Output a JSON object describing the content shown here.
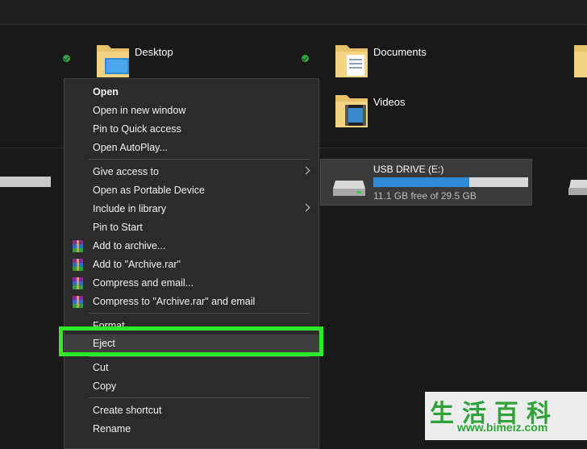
{
  "folders": [
    {
      "name": "Desktop"
    },
    {
      "name": "Documents"
    },
    {
      "name": "Videos"
    }
  ],
  "drive": {
    "name": "USB DRIVE (E:)",
    "free_text": "11.1 GB free of 29.5 GB",
    "used_fraction": 0.62,
    "fill_color": "#2f8bd6"
  },
  "context_menu": {
    "group1": [
      "Open",
      "Open in new window",
      "Pin to Quick access",
      "Open AutoPlay..."
    ],
    "group2": [
      "Give access to",
      "Open as Portable Device",
      "Include in library",
      "Pin to Start",
      "Add to archive...",
      "Add to \"Archive.rar\"",
      "Compress and email...",
      "Compress to \"Archive.rar\" and email"
    ],
    "group3": [
      "Format...",
      "Eject"
    ],
    "group4": [
      "Cut",
      "Copy"
    ],
    "group5": [
      "Create shortcut",
      "Rename"
    ]
  },
  "highlight_color": "#2dea2d",
  "watermark": {
    "chars": "生活百科",
    "url": "www.bimeiz.com"
  }
}
